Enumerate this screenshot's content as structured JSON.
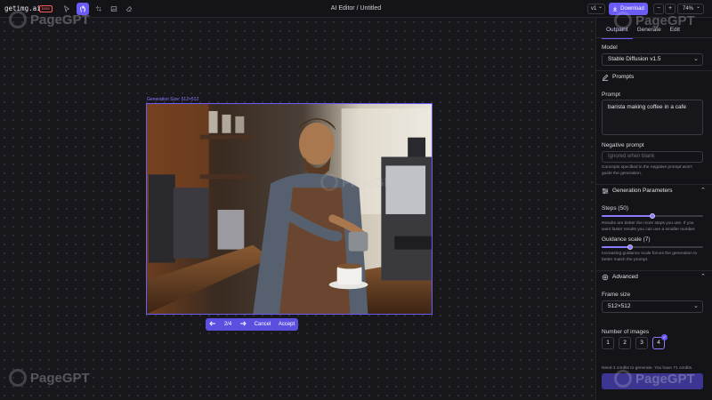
{
  "app": {
    "logo": "getimg.ai",
    "badge": "beta",
    "title": "AI Editor / Untitled"
  },
  "toolbar": {
    "tools": [
      "pointer-icon",
      "hand-icon",
      "crop-icon",
      "image-icon",
      "eraser-icon"
    ],
    "active_tool": "hand-icon",
    "version": "v1",
    "download_label": "Download",
    "zoom_out": "−",
    "zoom_in": "+",
    "zoom_level": "74%"
  },
  "canvas": {
    "generation_size": "Generation Size: 512×512",
    "nav": {
      "page": "2/4",
      "cancel": "Cancel",
      "accept": "Accept"
    },
    "watermark": "PageGPT"
  },
  "panel": {
    "tabs": [
      "Outpaint",
      "Generate",
      "Edit"
    ],
    "active_tab": "Outpaint",
    "model_label": "Model",
    "model_value": "Stable Diffusion v1.5",
    "prompts_section": "Prompts",
    "prompt_label": "Prompt",
    "prompt_value": "barista making coffee in a cafe",
    "negative_label": "Negative prompt",
    "negative_placeholder": "Ignored when blank",
    "negative_hint": "Concepts specified in the negative prompt won't guide the generation.",
    "gen_params_section": "Generation Parameters",
    "steps_label": "Steps (50)",
    "steps_value": 50,
    "steps_max": 100,
    "steps_hint": "Results are better the more steps you use. If you want faster results you can use a smaller number.",
    "guidance_label": "Guidance scale (7)",
    "guidance_value": 7,
    "guidance_max": 25,
    "guidance_hint": "Increasing guidance scale forces the generation to better match the prompt.",
    "advanced_section": "Advanced",
    "frame_label": "Frame size",
    "frame_value": "512×512",
    "images_label": "Number of images",
    "image_counts": [
      "1",
      "2",
      "3",
      "4"
    ],
    "selected_count": "4",
    "credits_text": "Need 4 credits to generate. You have 71 credits."
  },
  "colors": {
    "accent": "#6a5cf5",
    "background": "#15151a"
  }
}
